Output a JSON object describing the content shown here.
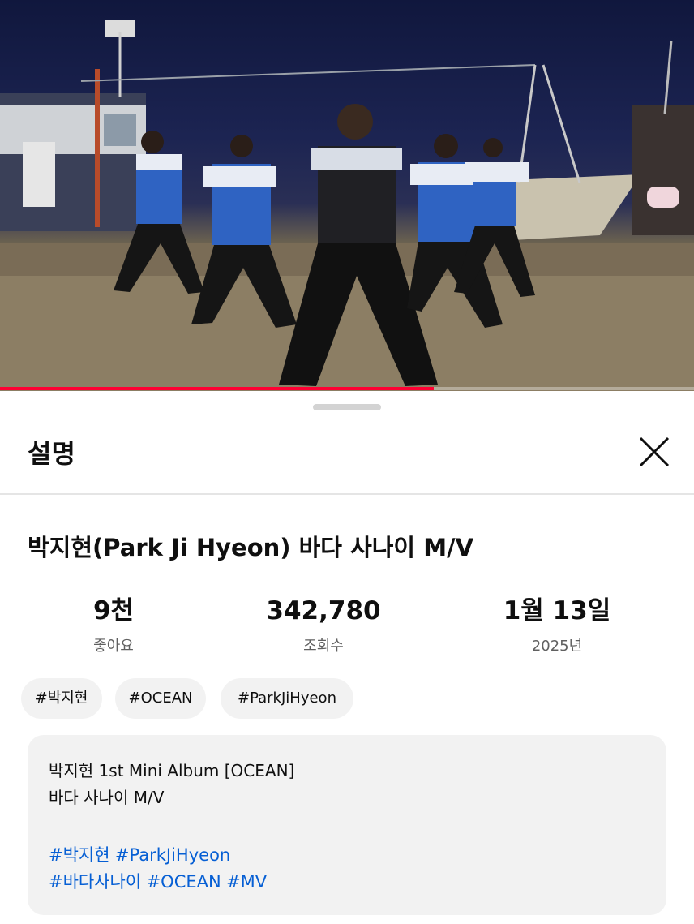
{
  "player": {
    "progress_fraction": 0.625,
    "accent_color": "#ff0033"
  },
  "description_panel": {
    "title": "설명",
    "close_icon": "close-icon",
    "video_title": "박지현(Park Ji Hyeon) 바다 사나이 M/V",
    "stats": {
      "likes": {
        "value": "9천",
        "label": "좋아요"
      },
      "views": {
        "value": "342,780",
        "label": "조회수"
      },
      "date": {
        "value": "1월 13일",
        "label": "2025년"
      }
    },
    "tags": [
      "#박지현",
      "#OCEAN",
      "#ParkJiHyeon"
    ],
    "description": {
      "line1": "박지현 1st Mini Album [OCEAN]",
      "line2": "바다 사나이 M/V",
      "hashtag_lines": [
        [
          "#박지현",
          "#ParkJiHyeon"
        ],
        [
          "#바다사나이",
          "#OCEAN",
          "#MV"
        ]
      ],
      "link_color": "#065fd4"
    }
  }
}
